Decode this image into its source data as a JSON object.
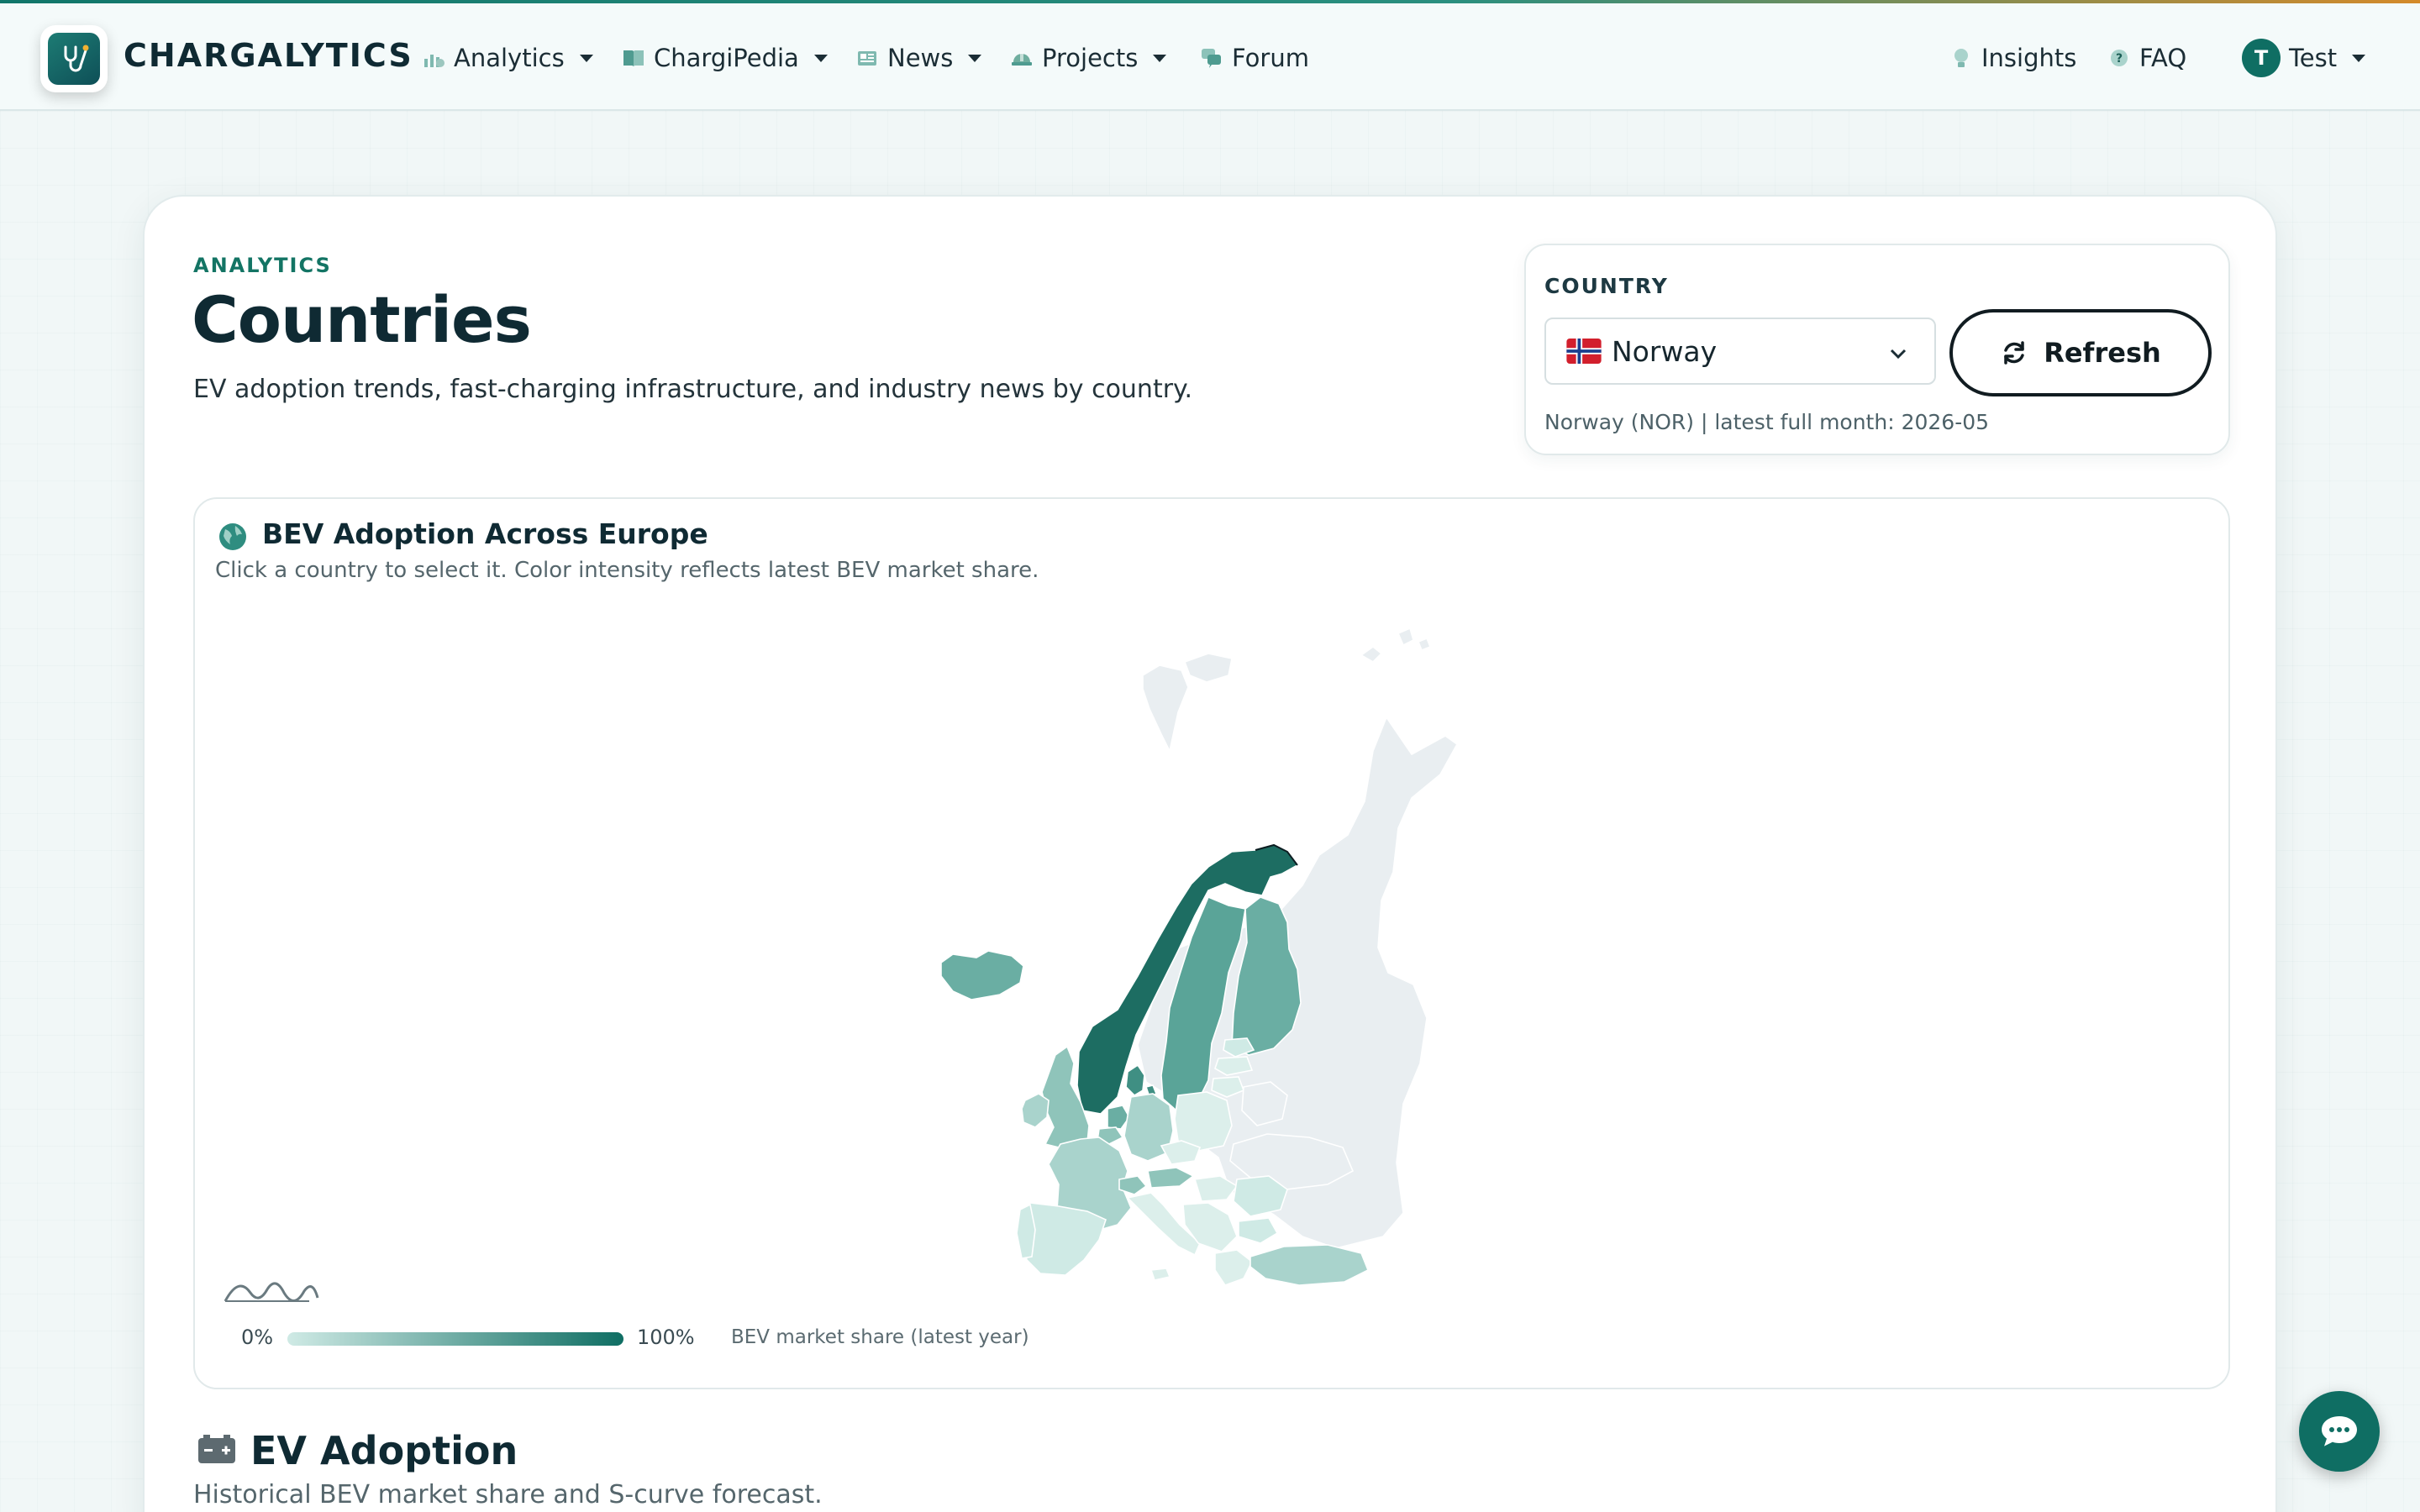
{
  "nav": {
    "brand": "CHARGALYTICS",
    "items": [
      {
        "label": "Analytics"
      },
      {
        "label": "ChargiPedia"
      },
      {
        "label": "News"
      },
      {
        "label": "Projects"
      },
      {
        "label": "Forum"
      }
    ],
    "insights": "Insights",
    "faq": "FAQ",
    "user_initial": "T",
    "user_name": "Test"
  },
  "page": {
    "eyebrow": "ANALYTICS",
    "title": "Countries",
    "subtitle": "EV adoption trends, fast-charging infrastructure, and industry news by country."
  },
  "country_panel": {
    "label": "COUNTRY",
    "selected": "Norway",
    "refresh_label": "Refresh",
    "meta": "Norway (NOR) | latest full month: 2026-05"
  },
  "map_panel": {
    "title": "BEV Adoption Across Europe",
    "subtitle": "Click a country to select it. Color intensity reflects latest BEV market share.",
    "legend_min": "0%",
    "legend_max": "100%",
    "legend_caption": "BEV market share (latest year)"
  },
  "section": {
    "title": "EV Adoption",
    "subtitle": "Historical BEV market share and S-curve forecast."
  },
  "colors": {
    "accent": "#0f6e63",
    "map_low": "#cfeae5",
    "map_high": "#0f6e63",
    "map_nodata": "#e9eef1"
  }
}
